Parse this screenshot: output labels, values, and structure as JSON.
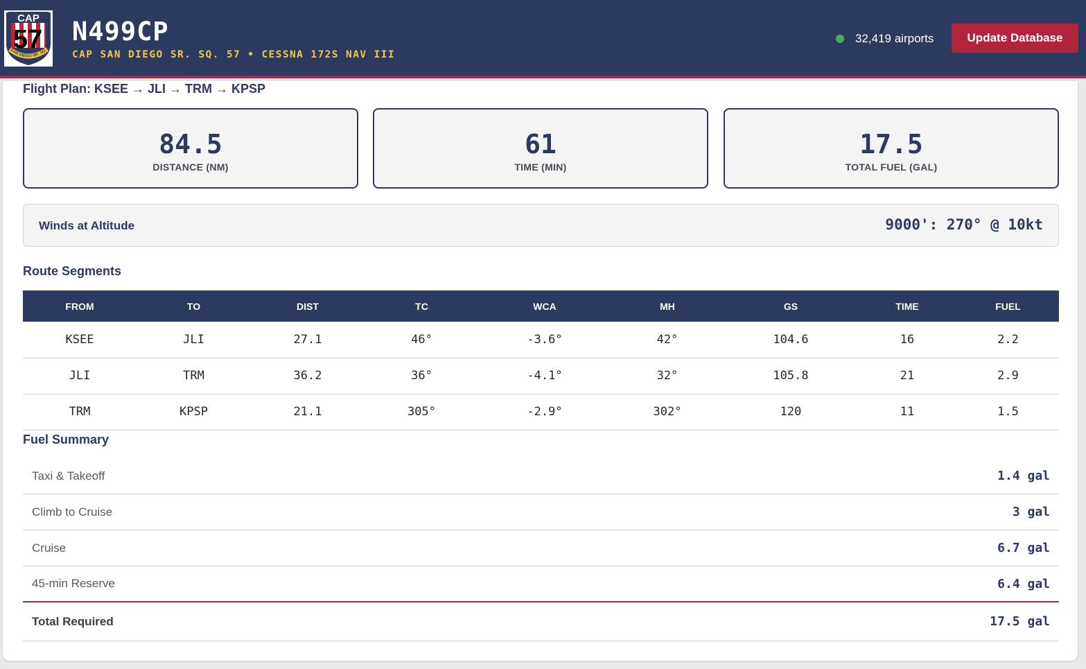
{
  "header": {
    "logo": {
      "icon": "cap-squadron-logo",
      "text_top": "CAP",
      "text_number": "57",
      "text_ring": "SAN DIEGO SR. SQ.",
      "colors": {
        "navy": "#2b3a5e",
        "red": "#c0283a",
        "gold": "#f2c744"
      }
    },
    "title": "N499CP",
    "subtitle": "CAP SAN DIEGO SR. SQ. 57 • CESSNA 172S NAV III",
    "status": {
      "text": "32,419 airports",
      "dot_color": "#4cae4f"
    },
    "update_button": "Update Database"
  },
  "flight_plan": {
    "title": "Flight Plan: KSEE → JLI → TRM → KPSP",
    "stats": [
      {
        "value": "84.5",
        "label": "DISTANCE (NM)"
      },
      {
        "value": "61",
        "label": "TIME (MIN)"
      },
      {
        "value": "17.5",
        "label": "TOTAL FUEL (GAL)"
      }
    ],
    "winds": {
      "label": "Winds at Altitude",
      "value": "9000': 270° @ 10kt"
    }
  },
  "segments": {
    "title": "Route Segments",
    "columns": [
      "FROM",
      "TO",
      "DIST",
      "TC",
      "WCA",
      "MH",
      "GS",
      "TIME",
      "FUEL"
    ],
    "rows": [
      [
        "KSEE",
        "JLI",
        "27.1",
        "46°",
        "-3.6°",
        "42°",
        "104.6",
        "16",
        "2.2"
      ],
      [
        "JLI",
        "TRM",
        "36.2",
        "36°",
        "-4.1°",
        "32°",
        "105.8",
        "21",
        "2.9"
      ],
      [
        "TRM",
        "KPSP",
        "21.1",
        "305°",
        "-2.9°",
        "302°",
        "120",
        "11",
        "1.5"
      ]
    ]
  },
  "fuel_summary": {
    "title": "Fuel Summary",
    "items": [
      {
        "label": "Taxi & Takeoff",
        "value": "1.4 gal"
      },
      {
        "label": "Climb to Cruise",
        "value": "3 gal"
      },
      {
        "label": "Cruise",
        "value": "6.7 gal"
      },
      {
        "label": "45-min Reserve",
        "value": "6.4 gal"
      }
    ],
    "total": {
      "label": "Total Required",
      "value": "17.5 gal"
    }
  },
  "theme": {
    "primary": "#2b3a5e",
    "accent": "#b0253a",
    "highlight": "#f2c744"
  }
}
